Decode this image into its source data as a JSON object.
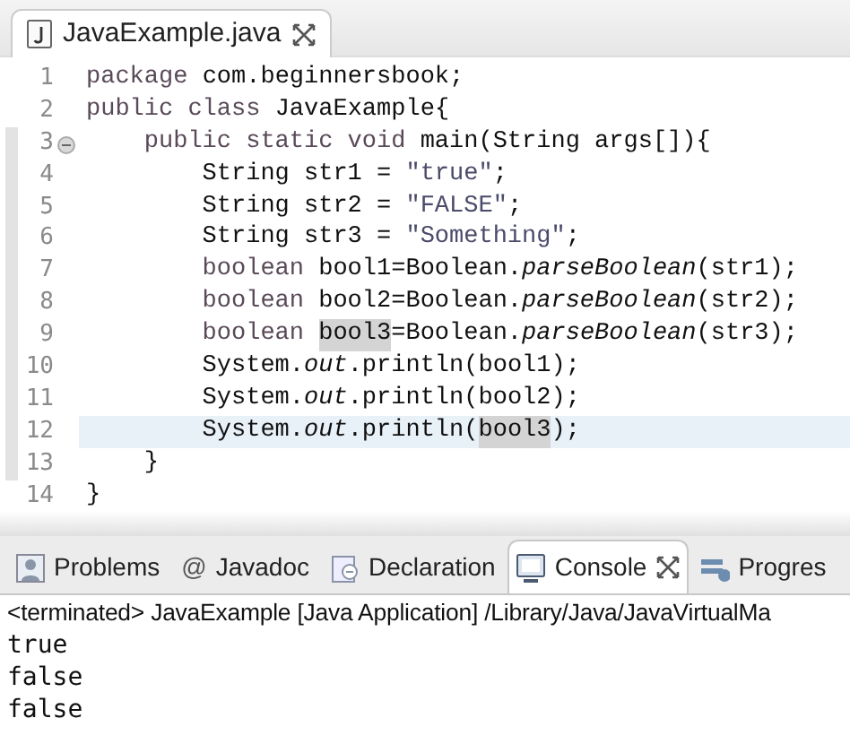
{
  "editor": {
    "tabs": [
      {
        "title": "JavaExample.java",
        "selected": true,
        "closable": true
      }
    ],
    "lines": [
      {
        "number": "1",
        "fold": false,
        "current": false,
        "range": false,
        "segments": [
          {
            "kind": "keyword",
            "text": "package "
          },
          {
            "kind": "plain",
            "text": "com.beginnersbook;"
          }
        ]
      },
      {
        "number": "2",
        "fold": false,
        "current": false,
        "range": false,
        "segments": [
          {
            "kind": "keyword",
            "text": "public class "
          },
          {
            "kind": "plain",
            "text": "JavaExample{"
          }
        ],
        "children": [
          {
            "number": "3",
            "fold": true,
            "current": false,
            "range": true,
            "segments": [
              {
                "kind": "keyword",
                "text": "public static void "
              },
              {
                "kind": "plain",
                "text": "main(String args[]){"
              }
            ],
            "children": [
              {
                "number": "4",
                "fold": false,
                "current": false,
                "range": true,
                "segments": [
                  {
                    "kind": "plain",
                    "text": "String str1 = "
                  },
                  {
                    "kind": "string",
                    "text": "\"true\""
                  },
                  {
                    "kind": "plain",
                    "text": ";"
                  }
                ]
              },
              {
                "number": "5",
                "fold": false,
                "current": false,
                "range": true,
                "segments": [
                  {
                    "kind": "plain",
                    "text": "String str2 = "
                  },
                  {
                    "kind": "string",
                    "text": "\"FALSE\""
                  },
                  {
                    "kind": "plain",
                    "text": ";"
                  }
                ]
              },
              {
                "number": "6",
                "fold": false,
                "current": false,
                "range": true,
                "segments": [
                  {
                    "kind": "plain",
                    "text": "String str3 = "
                  },
                  {
                    "kind": "string",
                    "text": "\"Something\""
                  },
                  {
                    "kind": "plain",
                    "text": ";"
                  }
                ]
              },
              {
                "number": "7",
                "fold": false,
                "current": false,
                "range": true,
                "segments": [
                  {
                    "kind": "keyword",
                    "text": "boolean "
                  },
                  {
                    "kind": "plain",
                    "text": "bool1=Boolean."
                  },
                  {
                    "kind": "method",
                    "text": "parseBoolean"
                  },
                  {
                    "kind": "plain",
                    "text": "(str1);"
                  }
                ]
              },
              {
                "number": "8",
                "fold": false,
                "current": false,
                "range": true,
                "segments": [
                  {
                    "kind": "keyword",
                    "text": "boolean "
                  },
                  {
                    "kind": "plain",
                    "text": "bool2=Boolean."
                  },
                  {
                    "kind": "method",
                    "text": "parseBoolean"
                  },
                  {
                    "kind": "plain",
                    "text": "(str2);"
                  }
                ]
              },
              {
                "number": "9",
                "fold": false,
                "current": false,
                "range": true,
                "segments": [
                  {
                    "kind": "keyword",
                    "text": "boolean "
                  },
                  {
                    "kind": "occurrence",
                    "text": "bool3"
                  },
                  {
                    "kind": "plain",
                    "text": "=Boolean."
                  },
                  {
                    "kind": "method",
                    "text": "parseBoolean"
                  },
                  {
                    "kind": "plain",
                    "text": "(str3);"
                  }
                ]
              },
              {
                "number": "10",
                "fold": false,
                "current": false,
                "range": true,
                "segments": [
                  {
                    "kind": "plain",
                    "text": "System."
                  },
                  {
                    "kind": "field",
                    "text": "out"
                  },
                  {
                    "kind": "plain",
                    "text": ".println(bool1);"
                  }
                ]
              },
              {
                "number": "11",
                "fold": false,
                "current": false,
                "range": true,
                "segments": [
                  {
                    "kind": "plain",
                    "text": "System."
                  },
                  {
                    "kind": "field",
                    "text": "out"
                  },
                  {
                    "kind": "plain",
                    "text": ".println(bool2);"
                  }
                ]
              },
              {
                "number": "12",
                "fold": false,
                "current": true,
                "range": true,
                "segments": [
                  {
                    "kind": "plain",
                    "text": "System."
                  },
                  {
                    "kind": "field",
                    "text": "out"
                  },
                  {
                    "kind": "plain",
                    "text": ".println("
                  },
                  {
                    "kind": "occurrence",
                    "text": "bool3"
                  },
                  {
                    "kind": "plain",
                    "text": ");"
                  }
                ]
              }
            ]
          },
          {
            "number": "13",
            "fold": false,
            "current": false,
            "range": true,
            "segments": [
              {
                "kind": "plain",
                "text": "}"
              }
            ]
          }
        ]
      },
      {
        "number": "14",
        "fold": false,
        "current": false,
        "range": false,
        "segments": [
          {
            "kind": "plain",
            "text": "}"
          }
        ]
      }
    ]
  },
  "panel": {
    "tabs": [
      {
        "label": "Problems",
        "selected": false,
        "closable": false
      },
      {
        "label": "Javadoc",
        "glyph": "@",
        "selected": false,
        "closable": false
      },
      {
        "label": "Declaration",
        "selected": false,
        "closable": false
      },
      {
        "label": "Console",
        "selected": true,
        "closable": true
      },
      {
        "label": "Progres",
        "selected": false,
        "closable": false
      }
    ],
    "console": {
      "header": "<terminated> JavaExample [Java Application] /Library/Java/JavaVirtualMa",
      "output": [
        "true",
        "false",
        "false"
      ]
    }
  }
}
